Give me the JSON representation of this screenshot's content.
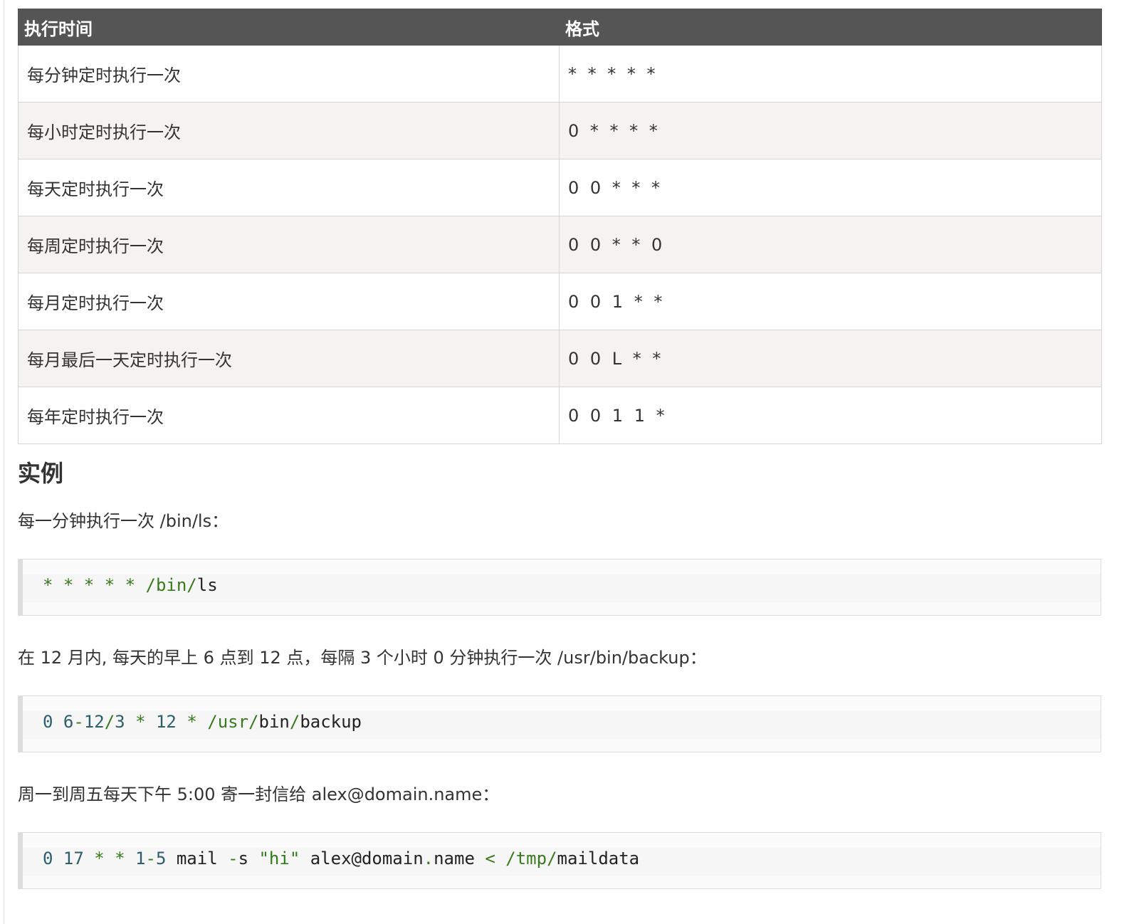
{
  "table": {
    "headers": [
      "执行时间",
      "格式"
    ],
    "rows": [
      {
        "desc": "每分钟定时执行一次",
        "format": "* * * * *"
      },
      {
        "desc": "每小时定时执行一次",
        "format": "0 * * * *"
      },
      {
        "desc": "每天定时执行一次",
        "format": "0 0 * * *"
      },
      {
        "desc": "每周定时执行一次",
        "format": "0 0 * * 0"
      },
      {
        "desc": "每月定时执行一次",
        "format": "0 0 1 * *"
      },
      {
        "desc": "每月最后一天定时执行一次",
        "format": "0 0 L * *"
      },
      {
        "desc": "每年定时执行一次",
        "format": "0 0 1 1 *"
      }
    ]
  },
  "section": {
    "title": "实例"
  },
  "examples": [
    {
      "text": "每一分钟执行一次 /bin/ls：",
      "code_tokens": [
        "* * * * * ",
        "/bin/",
        "ls"
      ]
    },
    {
      "text": "在 12 月内, 每天的早上 6 点到 12 点，每隔 3 个小时 0 分钟执行一次 /usr/bin/backup：",
      "code_tokens": [
        "0 6",
        "-",
        "12",
        "/",
        "3 ",
        "* ",
        "12 ",
        "* ",
        "/usr/",
        "bin",
        "/",
        "backup"
      ]
    },
    {
      "text": "周一到周五每天下午 5:00 寄一封信给 alex@domain.name：",
      "code_tokens": [
        "0 17 ",
        "* * ",
        "1",
        "-",
        "5 ",
        "mail ",
        "-",
        "s ",
        "\"hi\"",
        " alex@domain",
        ".",
        "name ",
        "< ",
        "/tmp/",
        "maildata"
      ]
    }
  ]
}
